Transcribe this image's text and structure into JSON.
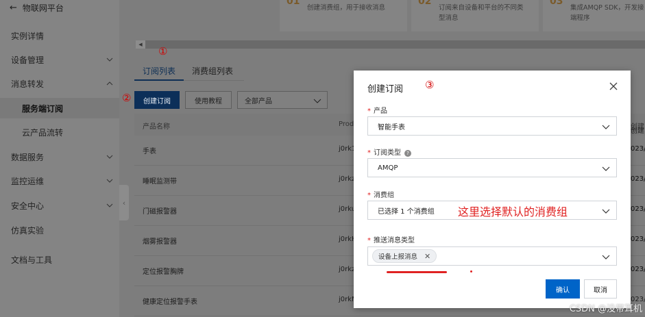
{
  "sidebar": {
    "back_label": "物联网平台",
    "items": [
      {
        "label": "实例详情"
      },
      {
        "label": "设备管理"
      },
      {
        "label": "消息转发"
      },
      {
        "label": "服务端订阅"
      },
      {
        "label": "云产品流转"
      },
      {
        "label": "数据服务"
      },
      {
        "label": "监控运维"
      },
      {
        "label": "安全中心"
      },
      {
        "label": "仿真实验"
      },
      {
        "label": "文档与工具"
      }
    ]
  },
  "cards": [
    {
      "num": "01",
      "line1": "创建消费组，用于接收消息",
      "line2": ""
    },
    {
      "num": "02",
      "line1": "订阅来自设备和平台的不同类",
      "line2": "型消息"
    },
    {
      "num": "03",
      "line1": "集成AMQP SDK，开发接",
      "line2": "端程序"
    }
  ],
  "tabs": [
    "订阅列表",
    "消费组列表"
  ],
  "toolbar": {
    "create_label": "创建订阅",
    "tutorial_label": "使用教程",
    "product_select": "全部产品"
  },
  "table": {
    "headers": [
      "产品名称",
      "Prod",
      "创建"
    ],
    "rows": [
      {
        "name": "手表",
        "product_key": "j0rk1",
        "date": "023/"
      },
      {
        "name": "睡眠监测带",
        "product_key": "j0rkz",
        "date": "023/"
      },
      {
        "name": "门磁报警器",
        "product_key": "j0rku",
        "date": "023/"
      },
      {
        "name": "烟雾报警器",
        "product_key": "j0rkH",
        "date": "023/"
      },
      {
        "name": "定位报警胸牌",
        "product_key": "j0rkz",
        "date": "023/"
      },
      {
        "name": "健康定位报警手表",
        "product_key": "j0rkM",
        "date": "023/"
      }
    ]
  },
  "annotations": {
    "step1": "①",
    "step2": "②",
    "step3": "③",
    "consumer_note": "这里选择默认的消费组"
  },
  "modal": {
    "title": "创建订阅",
    "product_label": "产品",
    "product_value": "智能手表",
    "type_label": "订阅类型",
    "type_value": "AMQP",
    "group_label": "消费组",
    "group_value": "已选择 1 个消费组",
    "push_label": "推送消息类型",
    "push_tag": "设备上报消息",
    "ok_label": "确认",
    "cancel_label": "取消"
  },
  "watermark": "CSDN @没带耳机",
  "colors": {
    "primary": "#0064c8",
    "annotation": "#e02222",
    "overlay": "#7d7d7d"
  }
}
